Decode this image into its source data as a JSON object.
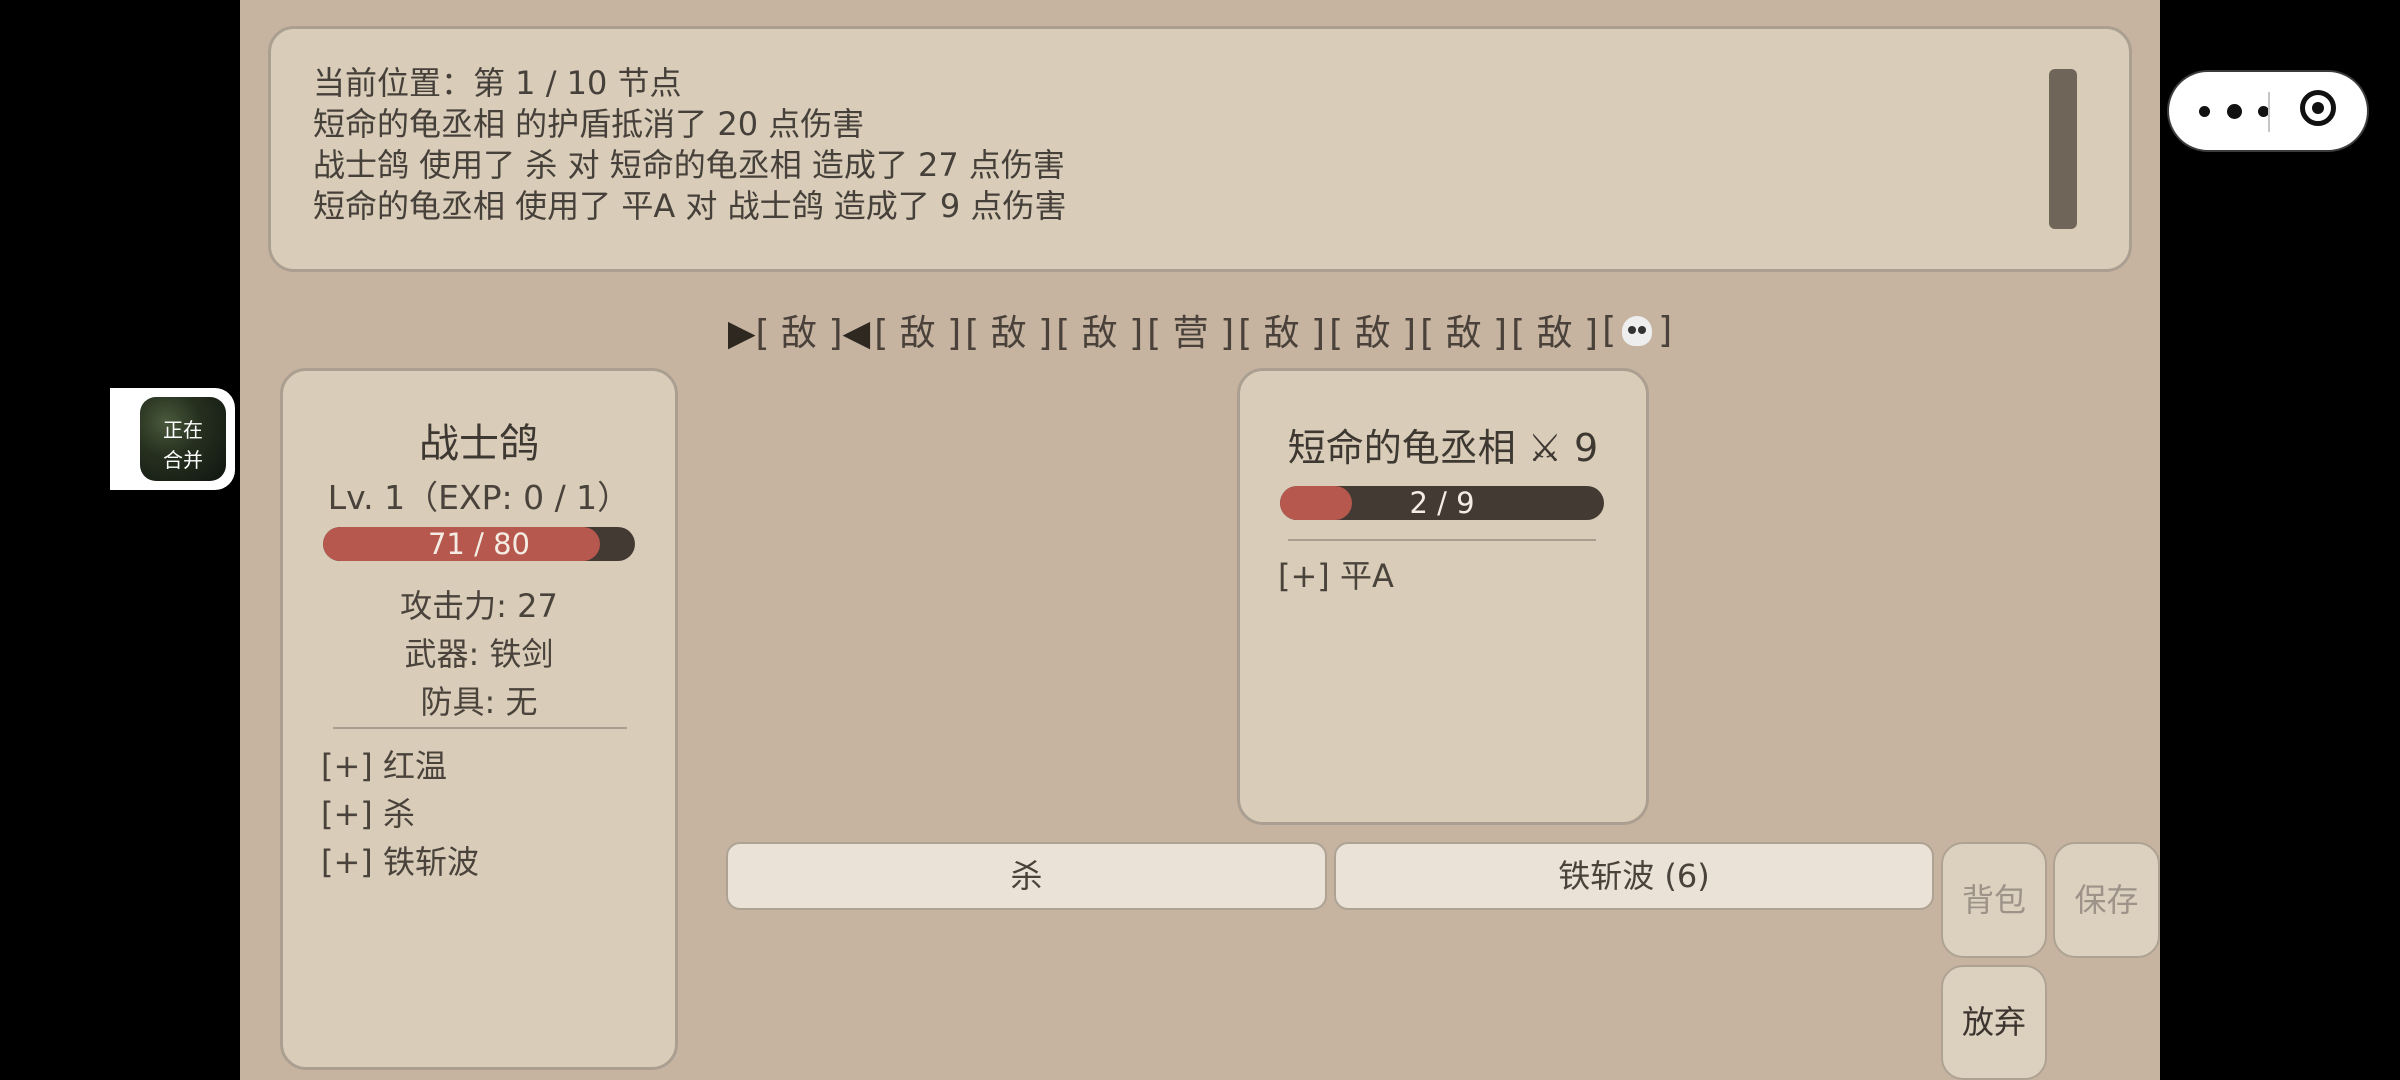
{
  "log": {
    "lines": [
      "当前位置：第 1 / 10 节点",
      "短命的龟丞相 的护盾抵消了 20 点伤害",
      "战士鸽 使用了 杀 对 短命的龟丞相 造成了 27 点伤害",
      "短命的龟丞相 使用了 平A 对 战士鸽 造成了 9 点伤害"
    ]
  },
  "route": {
    "current_marker_left": "▶",
    "current_marker_right": "◀",
    "nodes": [
      "[ 敌 ]",
      "[ 敌 ]",
      "[ 敌 ]",
      "[ 敌 ]",
      "[ 营 ]",
      "[ 敌 ]",
      "[ 敌 ]",
      "[ 敌 ]",
      "[ 敌 ]"
    ],
    "boss_open": "[",
    "boss_close": "]",
    "boss_icon": "skull-icon"
  },
  "player": {
    "name": "战士鸽",
    "level": "Lv. 1（EXP: 0 / 1）",
    "hp_text": "71 / 80",
    "hp_current": 71,
    "hp_max": 80,
    "attack": "攻击力: 27",
    "weapon": "武器: 铁剑",
    "armor": "防具: 无",
    "skills": [
      "[+] 红温",
      "[+] 杀",
      "[+] 铁斩波"
    ]
  },
  "enemy": {
    "name": "短命的龟丞相 ⚔ 9",
    "hp_text": "2 / 9",
    "hp_current": 2,
    "hp_max": 9,
    "skills": [
      "[+] 平A"
    ]
  },
  "actions": {
    "skill1": "杀",
    "skill2": "铁斩波 (6)",
    "bag": "背包",
    "save": "保存",
    "quit": "放弃"
  },
  "widget": {
    "merge_line1": "正在",
    "merge_line2": "合并"
  },
  "colors": {
    "background": "#c6b4a1",
    "panel": "#d9ccb8",
    "hp_fill": "#b6584e",
    "hp_track": "#433a33"
  }
}
